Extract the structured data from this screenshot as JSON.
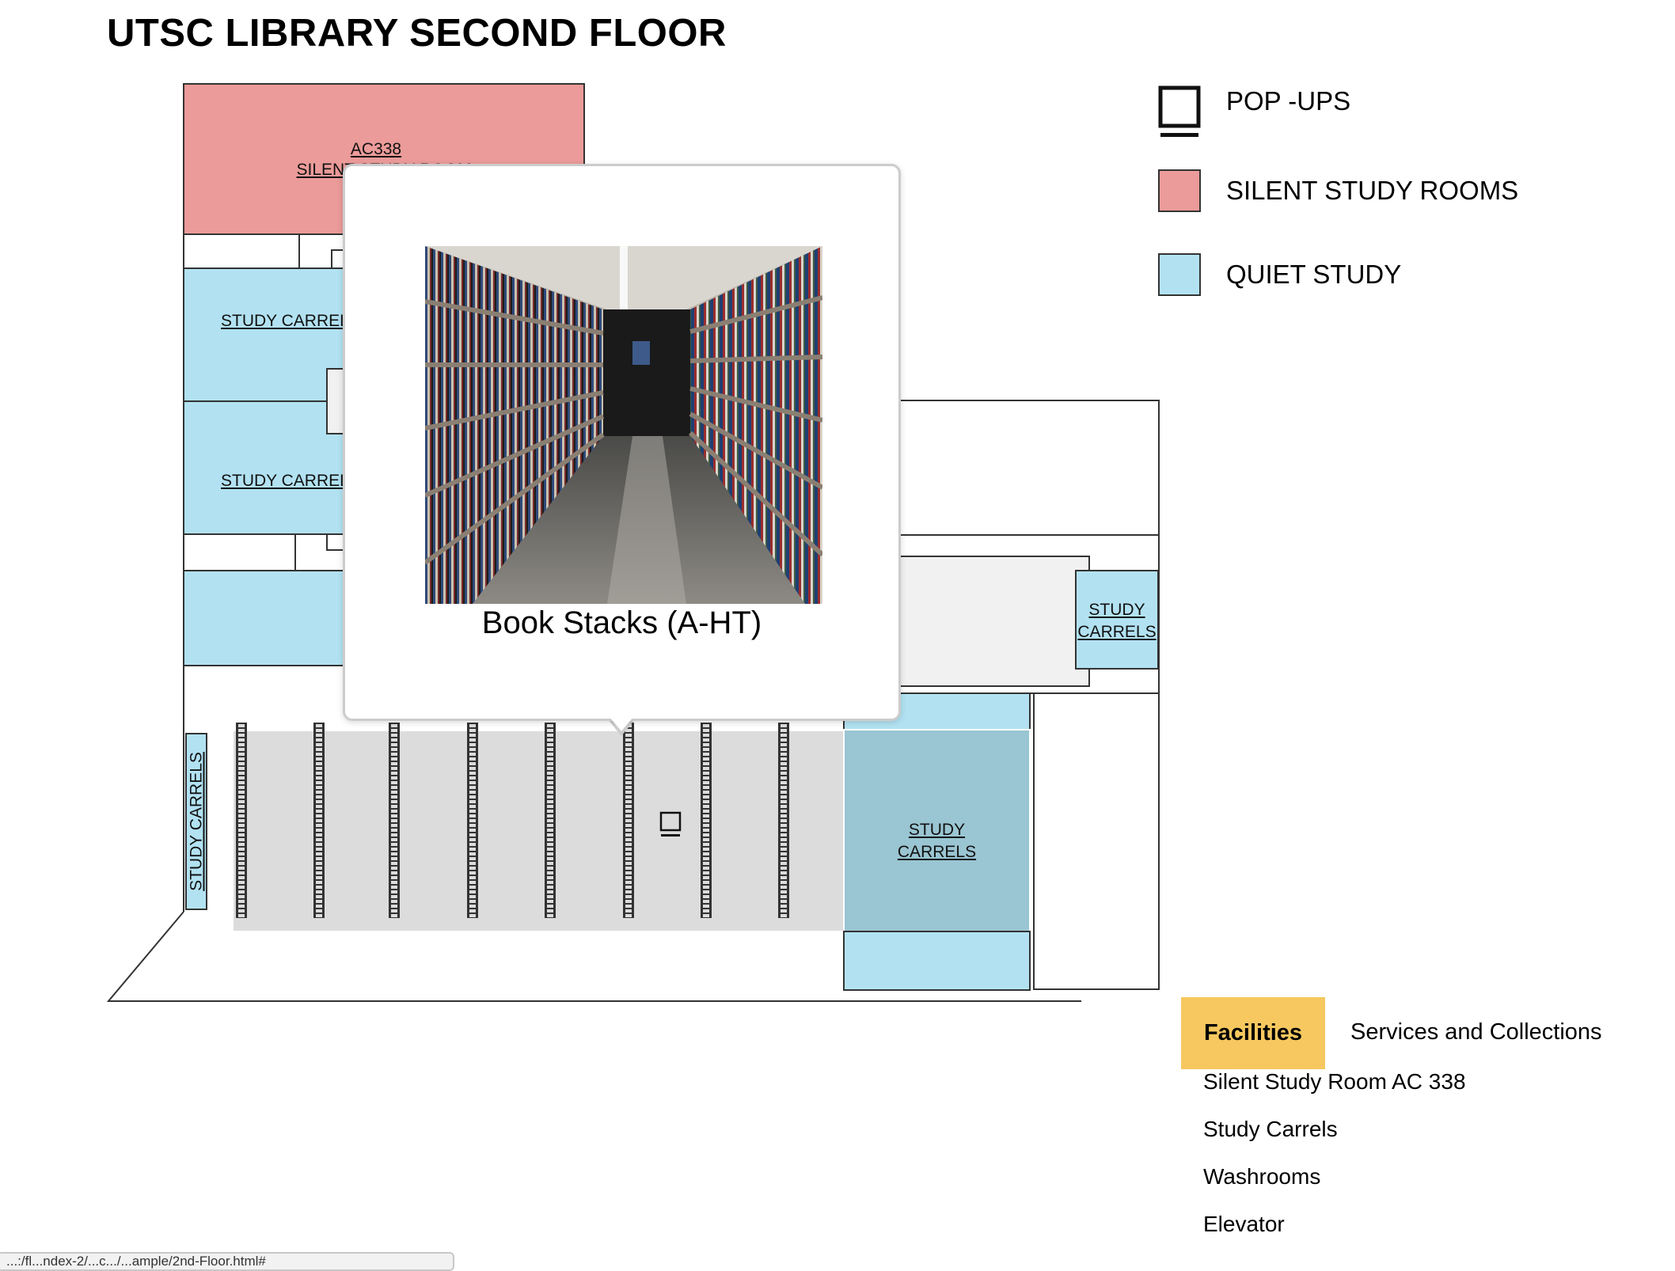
{
  "page_title": "UTSC LIBRARY SECOND FLOOR",
  "legend": [
    {
      "label": "POP -UPS",
      "icon": "popup-marker-icon"
    },
    {
      "label": "SILENT STUDY ROOMS",
      "color": "#eb9b99"
    },
    {
      "label": "QUIET STUDY",
      "color": "#b2e2f2"
    }
  ],
  "map_labels": {
    "ac338": "AC338",
    "ac338_sub": "SILENT STUDY ROOM",
    "carrels_upper": "STUDY CARRELS",
    "carrels_middle": "STUDY CARRELS",
    "carrels_vertical": "STUDY CARRELS",
    "carrels_right_1": "STUDY",
    "carrels_right_2": "CARRELS",
    "carrels_big_1": "STUDY",
    "carrels_big_2": "CARRELS"
  },
  "popup": {
    "caption": "Book Stacks (A-HT)",
    "image": "book-stacks-aisle-photo"
  },
  "tabs": {
    "facilities": "Facilities",
    "services": "Services and Collections"
  },
  "facilities_list": [
    "Silent Study Room AC 338",
    "Study Carrels",
    "Washrooms",
    "Elevator"
  ],
  "status_url": "...:/fl...ndex-2/...c.../...ample/2nd-Floor.html#"
}
